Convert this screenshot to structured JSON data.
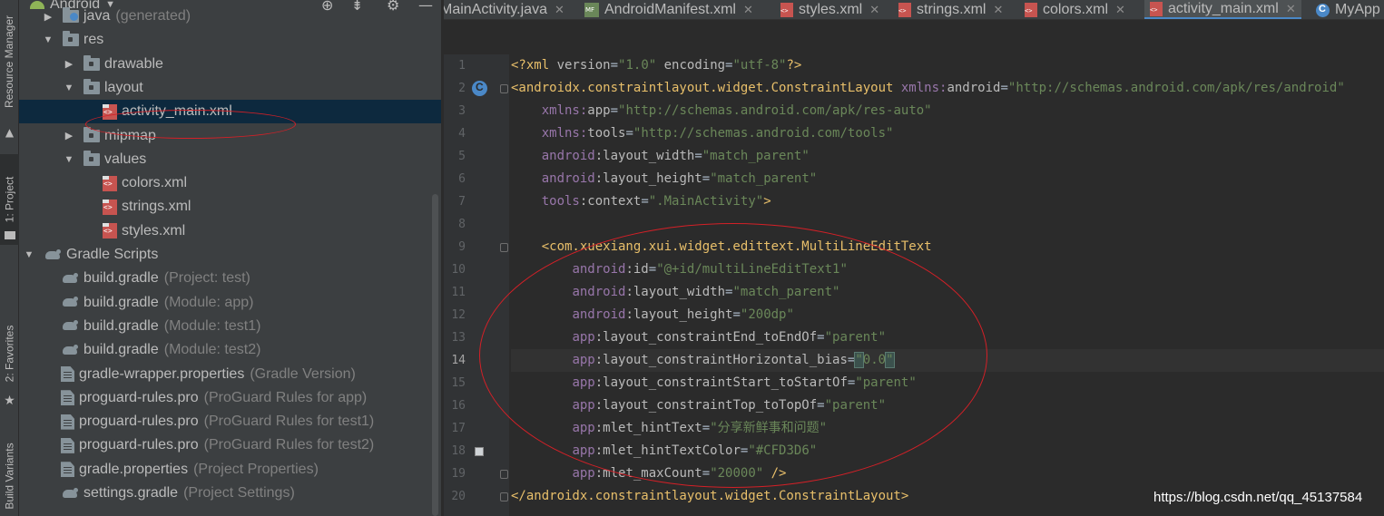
{
  "tool_strip": {
    "tabs": [
      {
        "label": "Resource Manager"
      },
      {
        "label": "1: Project",
        "active": true
      },
      {
        "label": "2: Favorites"
      },
      {
        "label": "Build Variants"
      }
    ]
  },
  "project_panel": {
    "title": "Android",
    "tree": [
      {
        "name": "java",
        "hint": "(generated)",
        "icon": "java-folder-icon",
        "arrow": "collapsed",
        "depth": 1,
        "generated": true
      },
      {
        "name": "res",
        "icon": "folder-icon",
        "arrow": "expanded",
        "depth": 1
      },
      {
        "name": "drawable",
        "icon": "folder-icon",
        "arrow": "collapsed",
        "depth": 2
      },
      {
        "name": "layout",
        "icon": "folder-icon",
        "arrow": "expanded",
        "depth": 2
      },
      {
        "name": "activity_main.xml",
        "icon": "xml-icon",
        "arrow": "none",
        "depth": 3,
        "selected": true
      },
      {
        "name": "mipmap",
        "icon": "folder-icon",
        "arrow": "collapsed",
        "depth": 2
      },
      {
        "name": "values",
        "icon": "folder-icon",
        "arrow": "expanded",
        "depth": 2
      },
      {
        "name": "colors.xml",
        "icon": "xml-icon",
        "arrow": "none",
        "depth": 3
      },
      {
        "name": "strings.xml",
        "icon": "xml-icon",
        "arrow": "none",
        "depth": 3
      },
      {
        "name": "styles.xml",
        "icon": "xml-icon",
        "arrow": "none",
        "depth": 3
      },
      {
        "name": "Gradle Scripts",
        "icon": "gradle-icon",
        "arrow": "expanded",
        "depth": 0
      },
      {
        "name": "build.gradle",
        "hint": "(Project: test)",
        "icon": "gradle-icon",
        "arrow": "none",
        "depth": 1
      },
      {
        "name": "build.gradle",
        "hint": "(Module: app)",
        "icon": "gradle-icon",
        "arrow": "none",
        "depth": 1
      },
      {
        "name": "build.gradle",
        "hint": "(Module: test1)",
        "icon": "gradle-icon",
        "arrow": "none",
        "depth": 1
      },
      {
        "name": "build.gradle",
        "hint": "(Module: test2)",
        "icon": "gradle-icon",
        "arrow": "none",
        "depth": 1
      },
      {
        "name": "gradle-wrapper.properties",
        "hint": "(Gradle Version)",
        "icon": "file-icon",
        "arrow": "none",
        "depth": 1
      },
      {
        "name": "proguard-rules.pro",
        "hint": "(ProGuard Rules for app)",
        "icon": "file-icon",
        "arrow": "none",
        "depth": 1
      },
      {
        "name": "proguard-rules.pro",
        "hint": "(ProGuard Rules for test1)",
        "icon": "file-icon",
        "arrow": "none",
        "depth": 1
      },
      {
        "name": "proguard-rules.pro",
        "hint": "(ProGuard Rules for test2)",
        "icon": "file-icon",
        "arrow": "none",
        "depth": 1
      },
      {
        "name": "gradle.properties",
        "hint": "(Project Properties)",
        "icon": "file-icon",
        "arrow": "none",
        "depth": 1
      },
      {
        "name": "settings.gradle",
        "hint": "(Project Settings)",
        "icon": "gradle-icon",
        "arrow": "none",
        "depth": 1
      }
    ]
  },
  "editor": {
    "tabs": [
      {
        "label": "MainActivity.java",
        "icon": "class-icon"
      },
      {
        "label": "AndroidManifest.xml",
        "icon": "manifest-icon"
      },
      {
        "label": "styles.xml",
        "icon": "xml-icon"
      },
      {
        "label": "strings.xml",
        "icon": "xml-icon"
      },
      {
        "label": "colors.xml",
        "icon": "xml-icon"
      },
      {
        "label": "activity_main.xml",
        "icon": "xml-icon",
        "active": true
      },
      {
        "label": "MyApp",
        "icon": "class-icon"
      }
    ],
    "current_line": 14,
    "lines": [
      {
        "n": "1",
        "tokens": [
          [
            "t-tag",
            "<?xml "
          ],
          [
            "t-attr",
            "version"
          ],
          [
            "t-plain",
            "="
          ],
          [
            "t-val",
            "\"1.0\""
          ],
          [
            "t-attr",
            " encoding"
          ],
          [
            "t-plain",
            "="
          ],
          [
            "t-val",
            "\"utf-8\""
          ],
          [
            "t-tag",
            "?>"
          ]
        ]
      },
      {
        "n": "2",
        "tokens": [
          [
            "t-tag",
            "<androidx.constraintlayout.widget.ConstraintLayout "
          ],
          [
            "t-ns",
            "xmlns:"
          ],
          [
            "t-attr",
            "android"
          ],
          [
            "t-plain",
            "="
          ],
          [
            "t-val",
            "\"http://schemas.android.com/apk/res/android\""
          ]
        ]
      },
      {
        "n": "3",
        "tokens": [
          [
            "t-plain",
            "    "
          ],
          [
            "t-ns",
            "xmlns:"
          ],
          [
            "t-attr",
            "app"
          ],
          [
            "t-plain",
            "="
          ],
          [
            "t-val",
            "\"http://schemas.android.com/apk/res-auto\""
          ]
        ]
      },
      {
        "n": "4",
        "tokens": [
          [
            "t-plain",
            "    "
          ],
          [
            "t-ns",
            "xmlns:"
          ],
          [
            "t-attr",
            "tools"
          ],
          [
            "t-plain",
            "="
          ],
          [
            "t-val",
            "\"http://schemas.android.com/tools\""
          ]
        ]
      },
      {
        "n": "5",
        "tokens": [
          [
            "t-plain",
            "    "
          ],
          [
            "t-ns",
            "android"
          ],
          [
            "t-attr",
            ":layout_width"
          ],
          [
            "t-plain",
            "="
          ],
          [
            "t-val",
            "\"match_parent\""
          ]
        ]
      },
      {
        "n": "6",
        "tokens": [
          [
            "t-plain",
            "    "
          ],
          [
            "t-ns",
            "android"
          ],
          [
            "t-attr",
            ":layout_height"
          ],
          [
            "t-plain",
            "="
          ],
          [
            "t-val",
            "\"match_parent\""
          ]
        ]
      },
      {
        "n": "7",
        "tokens": [
          [
            "t-plain",
            "    "
          ],
          [
            "t-ns",
            "tools"
          ],
          [
            "t-attr",
            ":context"
          ],
          [
            "t-plain",
            "="
          ],
          [
            "t-val",
            "\".MainActivity\""
          ],
          [
            "t-tag",
            ">"
          ]
        ]
      },
      {
        "n": "8",
        "tokens": []
      },
      {
        "n": "9",
        "tokens": [
          [
            "t-plain",
            "    "
          ],
          [
            "t-tag",
            "<com.xuexiang.xui.widget.edittext.MultiLineEditText"
          ]
        ]
      },
      {
        "n": "10",
        "tokens": [
          [
            "t-plain",
            "        "
          ],
          [
            "t-ns",
            "android"
          ],
          [
            "t-attr",
            ":id"
          ],
          [
            "t-plain",
            "="
          ],
          [
            "t-val",
            "\"@+id/multiLineEditText1\""
          ]
        ]
      },
      {
        "n": "11",
        "tokens": [
          [
            "t-plain",
            "        "
          ],
          [
            "t-ns",
            "android"
          ],
          [
            "t-attr",
            ":layout_width"
          ],
          [
            "t-plain",
            "="
          ],
          [
            "t-val",
            "\"match_parent\""
          ]
        ]
      },
      {
        "n": "12",
        "tokens": [
          [
            "t-plain",
            "        "
          ],
          [
            "t-ns",
            "android"
          ],
          [
            "t-attr",
            ":layout_height"
          ],
          [
            "t-plain",
            "="
          ],
          [
            "t-val",
            "\"200dp\""
          ]
        ]
      },
      {
        "n": "13",
        "tokens": [
          [
            "t-plain",
            "        "
          ],
          [
            "t-ns",
            "app"
          ],
          [
            "t-attr",
            ":layout_constraintEnd_toEndOf"
          ],
          [
            "t-plain",
            "="
          ],
          [
            "t-val",
            "\"parent\""
          ]
        ]
      },
      {
        "n": "14",
        "tokens": [
          [
            "t-plain",
            "        "
          ],
          [
            "t-ns",
            "app"
          ],
          [
            "t-attr",
            ":layout_constraintHorizontal_bias"
          ],
          [
            "t-plain",
            "="
          ],
          [
            "t-val caret-hl",
            "\""
          ],
          [
            "t-val",
            "0.0"
          ],
          [
            "t-val caret-hl",
            "\""
          ]
        ]
      },
      {
        "n": "15",
        "tokens": [
          [
            "t-plain",
            "        "
          ],
          [
            "t-ns",
            "app"
          ],
          [
            "t-attr",
            ":layout_constraintStart_toStartOf"
          ],
          [
            "t-plain",
            "="
          ],
          [
            "t-val",
            "\"parent\""
          ]
        ]
      },
      {
        "n": "16",
        "tokens": [
          [
            "t-plain",
            "        "
          ],
          [
            "t-ns",
            "app"
          ],
          [
            "t-attr",
            ":layout_constraintTop_toTopOf"
          ],
          [
            "t-plain",
            "="
          ],
          [
            "t-val",
            "\"parent\""
          ]
        ]
      },
      {
        "n": "17",
        "tokens": [
          [
            "t-plain",
            "        "
          ],
          [
            "t-ns",
            "app"
          ],
          [
            "t-attr",
            ":mlet_hintText"
          ],
          [
            "t-plain",
            "="
          ],
          [
            "t-val",
            "\"分享新鲜事和问题\""
          ]
        ]
      },
      {
        "n": "18",
        "tokens": [
          [
            "t-plain",
            "        "
          ],
          [
            "t-ns",
            "app"
          ],
          [
            "t-attr",
            ":mlet_hintTextColor"
          ],
          [
            "t-plain",
            "="
          ],
          [
            "t-val",
            "\"#CFD3D6\""
          ]
        ]
      },
      {
        "n": "19",
        "tokens": [
          [
            "t-plain",
            "        "
          ],
          [
            "t-ns",
            "app"
          ],
          [
            "t-attr",
            ":mlet_maxCount"
          ],
          [
            "t-plain",
            "="
          ],
          [
            "t-val",
            "\"20000\""
          ],
          [
            "t-tag",
            " />"
          ]
        ]
      },
      {
        "n": "20",
        "tokens": [
          [
            "t-tag",
            "</androidx.constraintlayout.widget.ConstraintLayout>"
          ]
        ]
      }
    ]
  },
  "watermark": "https://blog.csdn.net/qq_45137584",
  "colors": {
    "panel_bg": "#3c3f41",
    "editor_bg": "#2b2b2b",
    "selection": "#0d293e",
    "annotation_red": "#d42027",
    "swatch": "#CFD3D6"
  }
}
